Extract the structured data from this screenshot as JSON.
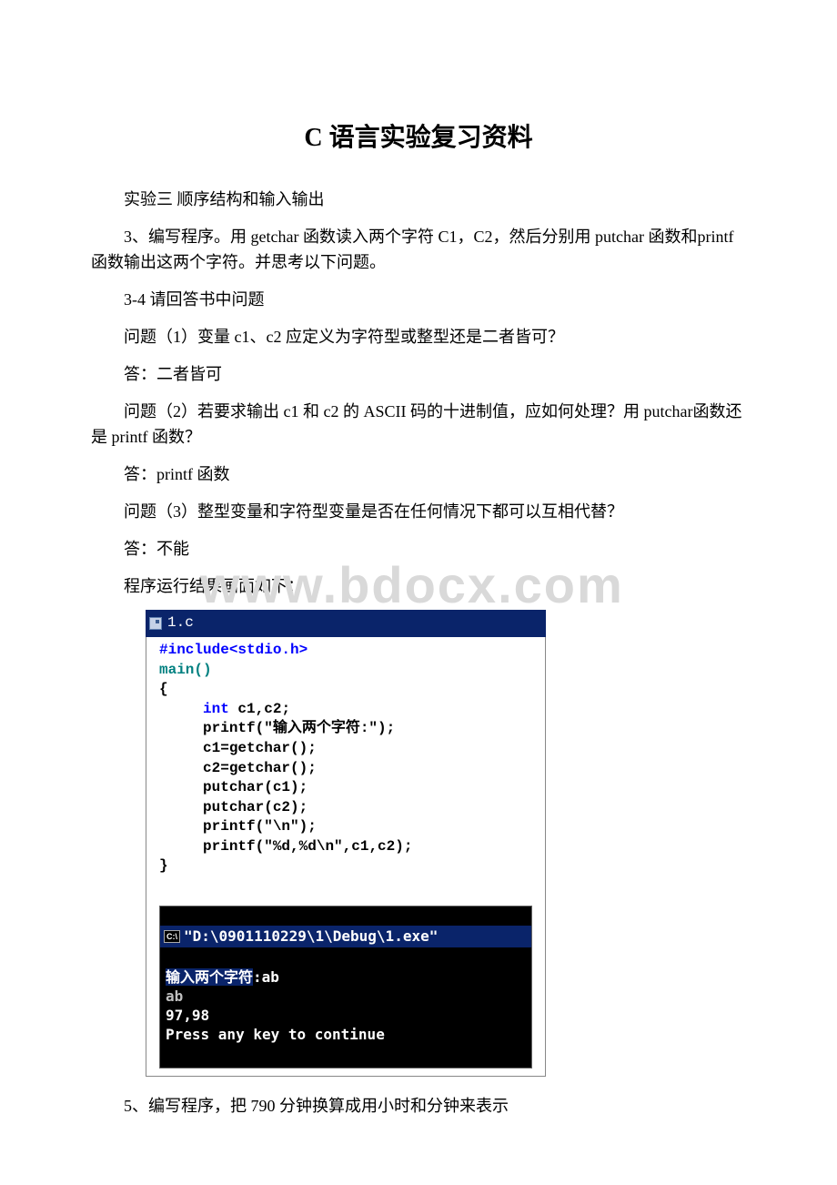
{
  "title": "C 语言实验复习资料",
  "p1": "实验三 顺序结构和输入输出",
  "p2": "3、编写程序。用 getchar 函数读入两个字符 C1，C2，然后分别用 putchar 函数和printf 函数输出这两个字符。并思考以下问题。",
  "p3": "3-4 请回答书中问题",
  "p4": "问题（1）变量 c1、c2 应定义为字符型或整型还是二者皆可？",
  "p5": "答：二者皆可",
  "p6": "问题（2）若要求输出 c1 和 c2 的 ASCII 码的十进制值，应如何处理？用 putchar函数还是 printf 函数？",
  "p7": "答：printf 函数",
  "p8": "问题（3）整型变量和字符型变量是否在任何情况下都可以互相代替？",
  "p9": "答：不能",
  "p10": "程序运行结果画面如下：",
  "watermark": "www.bdocx.com",
  "code": {
    "file": "1.c",
    "include": "#include<stdio.h>",
    "l_main": "main()",
    "l_brace_open": "{",
    "l_decl_kw": "int",
    "l_decl_rest": " c1,c2;",
    "l_printf1": "printf(\"输入两个字符:\");",
    "l_get1": "c1=getchar();",
    "l_get2": "c2=getchar();",
    "l_put1": "putchar(c1);",
    "l_put2": "putchar(c2);",
    "l_pn": "printf(\"\\n\");",
    "l_printf2": "printf(\"%d,%d\\n\",c1,c2);",
    "l_brace_close": "}"
  },
  "console": {
    "icon": "C:\\",
    "title": "\"D:\\0901110229\\1\\Debug\\1.exe\"",
    "line1a": "输入两个字符",
    "line1b": ":ab",
    "line2": "ab",
    "line3": "97,98",
    "line4": "Press any key to continue"
  },
  "p11": "5、编写程序，把 790 分钟换算成用小时和分钟来表示"
}
